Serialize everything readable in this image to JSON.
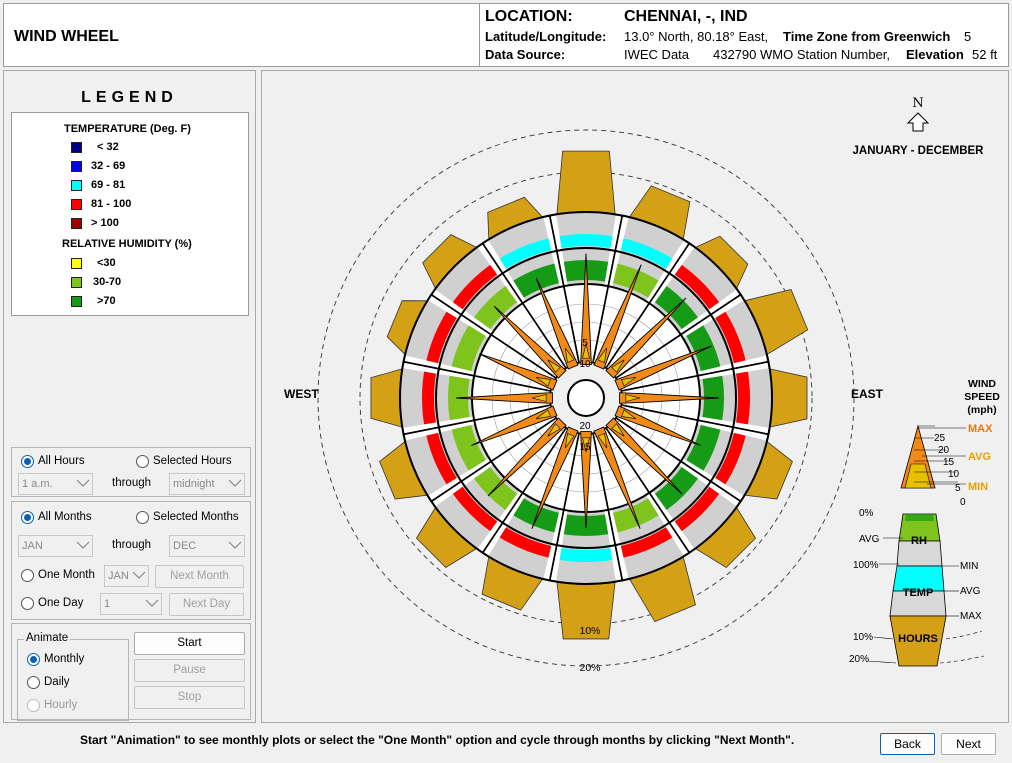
{
  "app": {
    "title": "WIND WHEEL"
  },
  "header": {
    "location_label": "LOCATION:",
    "location_value": "CHENNAI, -, IND",
    "latlon_label": "Latitude/Longitude:",
    "latlon_value": "13.0° North, 80.18° East,",
    "timezone_label": "Time Zone from Greenwich",
    "timezone_value": "5",
    "source_label": "Data Source:",
    "source_value": "IWEC Data",
    "station_value": "432790 WMO Station Number,",
    "elevation_label": "Elevation",
    "elevation_value": "52 ft"
  },
  "legend": {
    "title": "LEGEND",
    "temperature_heading": "TEMPERATURE (Deg. F)",
    "temperature_items": [
      {
        "label": "< 32",
        "color": "#00008b"
      },
      {
        "label": "32  -  69",
        "color": "#0000ff"
      },
      {
        "label": "69  -  81",
        "color": "#00ffff"
      },
      {
        "label": "81  -  100",
        "color": "#ff0000"
      },
      {
        "label": "> 100",
        "color": "#a00000"
      }
    ],
    "humidity_heading": "RELATIVE HUMIDITY (%)",
    "humidity_items": [
      {
        "label": "<30",
        "color": "#ffff00"
      },
      {
        "label": "30-70",
        "color": "#7fc41c"
      },
      {
        "label": ">70",
        "color": "#159b15"
      }
    ]
  },
  "hours": {
    "all_label": "All Hours",
    "selected_label": "Selected Hours",
    "from_value": "1 a.m.",
    "through_label": "through",
    "to_value": "midnight"
  },
  "months": {
    "all_label": "All Months",
    "selected_label": "Selected Months",
    "from_value": "JAN",
    "through_label": "through",
    "to_value": "DEC",
    "one_month_label": "One Month",
    "one_month_value": "JAN",
    "next_month_label": "Next Month",
    "one_day_label": "One Day",
    "one_day_value": "1",
    "next_day_label": "Next Day"
  },
  "animate": {
    "legend": "Animate",
    "monthly_label": "Monthly",
    "daily_label": "Daily",
    "hourly_label": "Hourly",
    "start_label": "Start",
    "pause_label": "Pause",
    "stop_label": "Stop"
  },
  "wheel": {
    "north_label": "N",
    "period_label": "JANUARY - DECEMBER",
    "west_label": "WEST",
    "east_label": "EAST",
    "ring_labels": [
      "5",
      "10",
      "15",
      "20"
    ],
    "hours_ring_labels": [
      "10%",
      "20%"
    ]
  },
  "key": {
    "title": [
      "WIND",
      "SPEED",
      "(mph)"
    ],
    "speed_ticks": [
      "25",
      "20",
      "15",
      "10",
      "5",
      "0"
    ],
    "max_label": "MAX",
    "avg_label": "AVG",
    "min_label": "MIN",
    "rh_label": "RH",
    "rh_ticks": [
      "0%",
      "AVG",
      "100%"
    ],
    "temp_label": "TEMP",
    "temp_ticks": [
      "MIN",
      "AVG",
      "MAX"
    ],
    "hours_label": "HOURS",
    "hours_ticks": [
      "10%",
      "20%"
    ],
    "colors": {
      "max": "#e8760a",
      "avg": "#e8a000",
      "min": "#e8a000",
      "spike": "#f28a1a",
      "hours": "#d4a016"
    }
  },
  "footer": {
    "message": "Start \"Animation\" to see monthly plots or select the \"One Month\" option and cycle through months by clicking \"Next Month\".",
    "back_label": "Back",
    "next_label": "Next"
  }
}
